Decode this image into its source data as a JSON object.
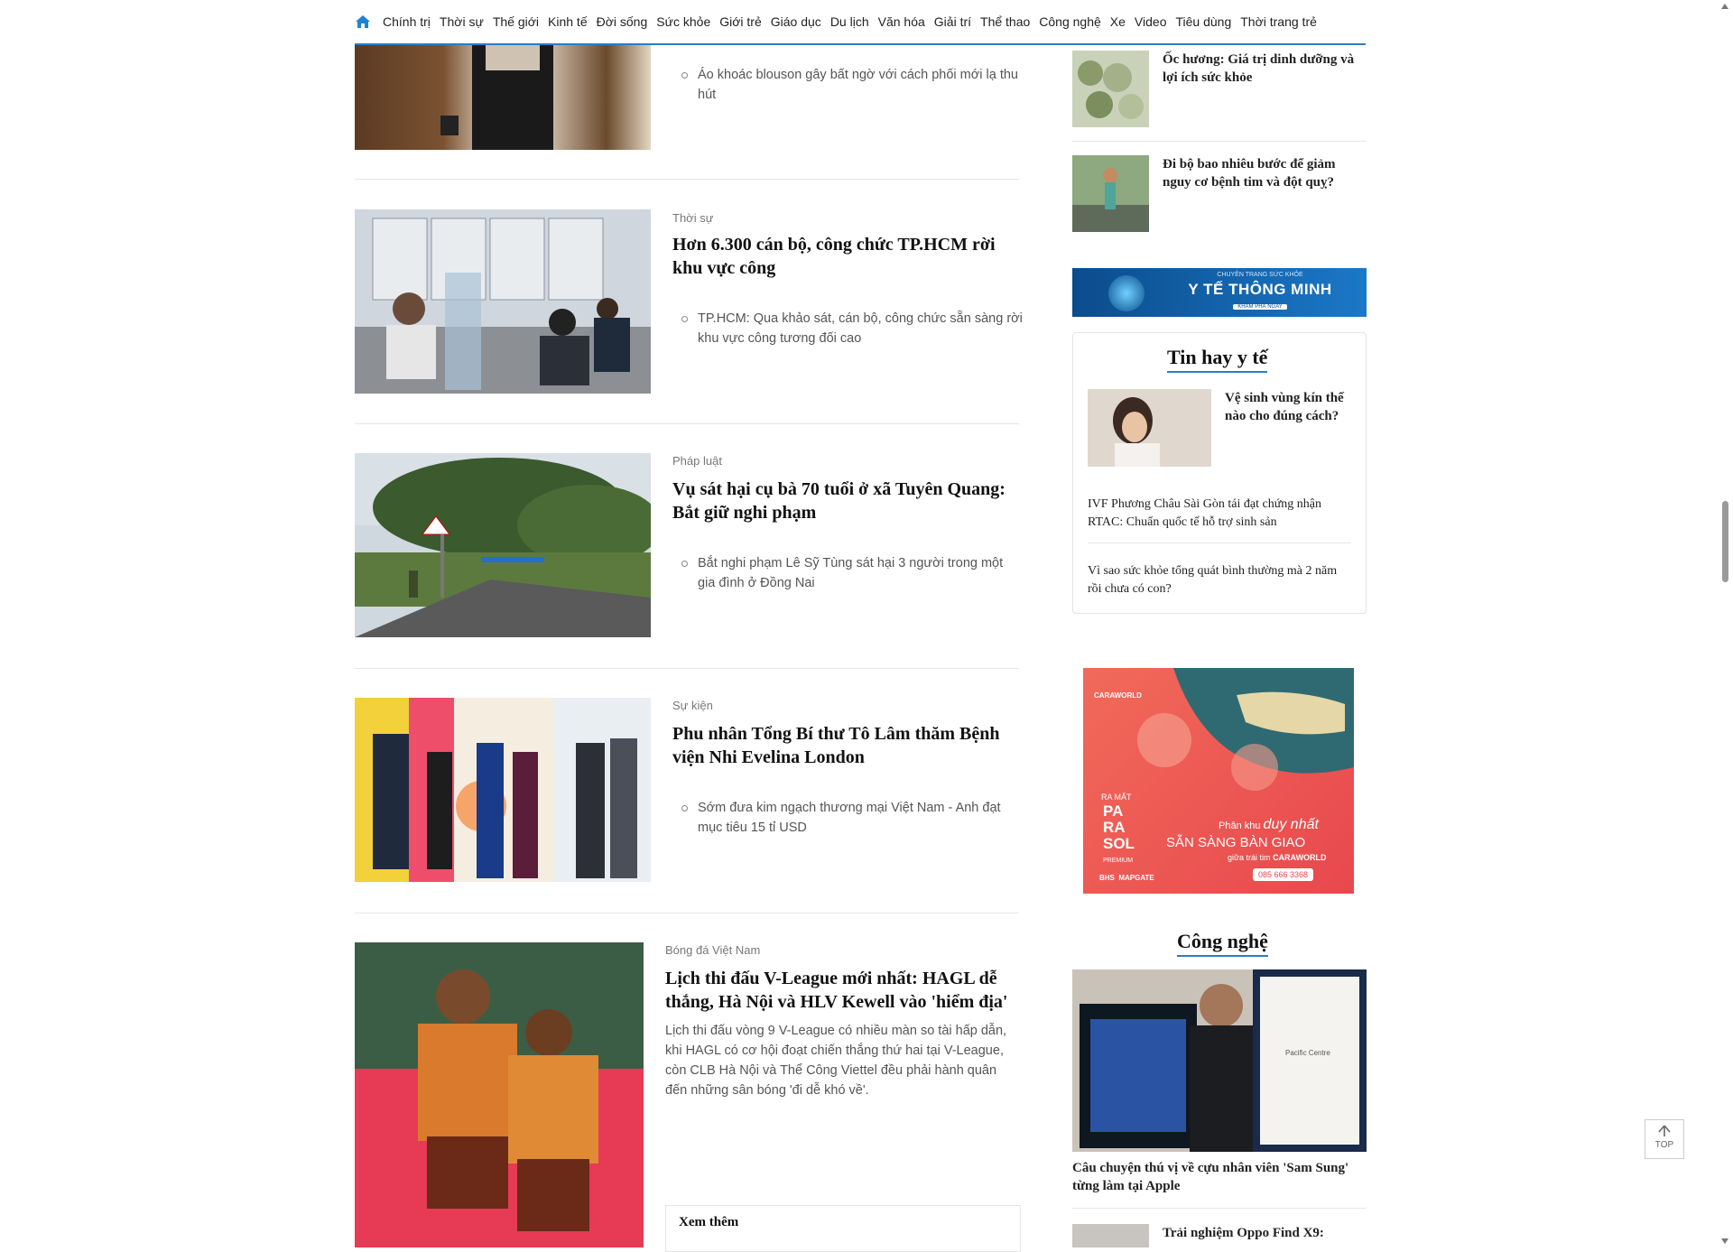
{
  "nav": {
    "items": [
      "Chính trị",
      "Thời sự",
      "Thế giới",
      "Kinh tế",
      "Đời sống",
      "Sức khỏe",
      "Giới trẻ",
      "Giáo dục",
      "Du lịch",
      "Văn hóa",
      "Giải trí",
      "Thể thao",
      "Công nghệ",
      "Xe",
      "Video",
      "Tiêu dùng",
      "Thời trang trẻ"
    ]
  },
  "articles": [
    {
      "bullet": "Áo khoác blouson gây bất ngờ với cách phối mới lạ thu hút"
    },
    {
      "category": "Thời sự",
      "title": "Hơn 6.300 cán bộ, công chức TP.HCM rời khu vực công",
      "bullet": "TP.HCM: Qua khảo sát, cán bộ, công chức sẵn sàng rời khu vực công tương đối cao"
    },
    {
      "category": "Pháp luật",
      "title": "Vụ sát hại cụ bà 70 tuổi ở xã Tuyên Quang: Bắt giữ nghi phạm",
      "bullet": "Bắt nghi phạm Lê Sỹ Tùng sát hại 3 người trong một gia đình ở Đồng Nai"
    },
    {
      "category": "Sự kiện",
      "title": "Phu nhân Tổng Bí thư Tô Lâm thăm Bệnh viện Nhi Evelina London",
      "bullet": "Sớm đưa kim ngạch thương mại Việt Nam - Anh đạt mục tiêu 15 tỉ USD"
    },
    {
      "category": "Bóng đá Việt Nam",
      "title": "Lịch thi đấu V-League mới nhất: HAGL dễ thắng, Hà Nội và HLV Kewell vào 'hiểm địa'",
      "sapo": "Lịch thi đấu vòng 9 V-League có nhiều màn so tài hấp dẫn, khi HAGL có cơ hội đoạt chiến thắng thứ hai tại V-League, còn CLB Hà Nội và Thể Công Viettel đều phải hành quân đến những sân bóng 'đi dễ khó về'.",
      "more_label": "Xem thêm"
    }
  ],
  "sidebar": {
    "top_items": [
      {
        "title": "Ốc hương: Giá trị dinh dưỡng và lợi ích sức khỏe"
      },
      {
        "title": "Đi bộ bao nhiêu bước để giảm nguy cơ bệnh tim và đột quỵ?"
      }
    ],
    "banner": {
      "small": "CHUYÊN TRANG SỨC KHỎE",
      "big": "Y TẾ THÔNG MINH",
      "btn": "KHÁM PHÁ NGAY"
    },
    "tin_hay": {
      "heading": "Tin hay y tế",
      "lead": "Vệ sinh vùng kín thế nào cho đúng cách?",
      "items": [
        "IVF Phương Châu Sài Gòn tái đạt chứng nhận RTAC: Chuẩn quốc tế hỗ trợ sinh sản",
        "Vì sao sức khỏe tổng quát bình thường mà 2 năm rồi chưa có con?"
      ]
    },
    "ad": {
      "brand": "CARAWORLD",
      "launch": "RA MẮT",
      "parasol": [
        "PA",
        "RA",
        "SOL"
      ],
      "premium": "PREMIUM",
      "line1": "Phân khu",
      "line1b": "duy nhất",
      "line2": "SẴN SÀNG BÀN GIAO",
      "line3": "giữa trái tim",
      "line3b": "CARAWORLD",
      "phone": "085 666 3368",
      "logos": [
        "BHS",
        "MAPGATE"
      ]
    },
    "cong_nghe": {
      "heading": "Công nghệ",
      "lead": "Câu chuyện thú vị về cựu nhân viên 'Sam Sung' từng làm tại Apple",
      "card_text": "Pacific Centre",
      "next": "Trải nghiệm Oppo Find X9:"
    }
  },
  "top_button": "TOP",
  "colors": {
    "accent": "#2e7cc0"
  }
}
